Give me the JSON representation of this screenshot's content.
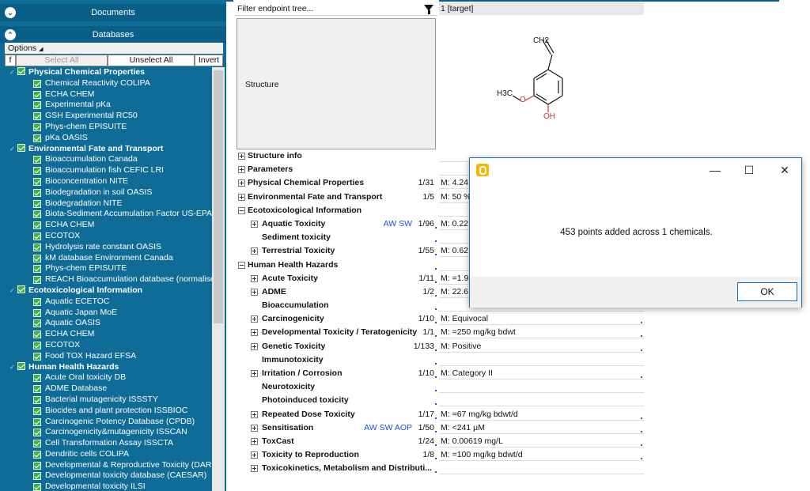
{
  "left_panel": {
    "documents_label": "Documents",
    "databases_label": "Databases",
    "options_label": "Options",
    "f_button": "f",
    "select_all": "Select All",
    "unselect_all": "Unselect All",
    "invert": "Invert",
    "categories": [
      {
        "name": "Physical Chemical Properties",
        "items": [
          "Chemical Reactivity COLIPA",
          "ECHA CHEM",
          "Experimental pKa",
          "GSH Experimental RC50",
          "Phys-chem EPISUITE",
          "pKa OASIS"
        ]
      },
      {
        "name": "Environmental Fate and Transport",
        "items": [
          "Bioaccumulation Canada",
          "Bioaccumulation fish CEFIC LRI",
          "Bioconcentration NITE",
          "Biodegradation in soil OASIS",
          "Biodegradation NITE",
          "Biota-Sediment Accumulation Factor US-EPA",
          "ECHA CHEM",
          "ECOTOX",
          "Hydrolysis rate constant OASIS",
          "kM database Environment Canada",
          "Phys-chem EPISUITE",
          "REACH Bioaccumulation database (normalised"
        ]
      },
      {
        "name": "Ecotoxicological Information",
        "items": [
          "Aquatic ECETOC",
          "Aquatic Japan MoE",
          "Aquatic OASIS",
          "ECHA CHEM",
          "ECOTOX",
          "Food TOX Hazard EFSA"
        ]
      },
      {
        "name": "Human Health Hazards",
        "items": [
          "Acute Oral toxicity DB",
          "ADME Database",
          "Bacterial mutagenicity ISSSTY",
          "Biocides and plant protection ISSBIOC",
          "Carcinogenic Potency Database (CPDB)",
          "Carcinogenicity&mutagenicity ISSCAN",
          "Cell Transformation Assay ISSCTA",
          "Dendritic cells COLIPA",
          "Developmental & Reproductive Toxicity (DAR",
          "Developmental toxicity database (CAESAR)",
          "Developmental toxicity ILSI"
        ]
      }
    ]
  },
  "center": {
    "filter_placeholder": "Filter endpoint tree...",
    "structure_label": "Structure",
    "target_label": "1 [target]",
    "rows": [
      {
        "name": "Structure info",
        "level": 0,
        "pm": "plus",
        "count": "",
        "tag": "",
        "value": ""
      },
      {
        "name": "Parameters",
        "level": 0,
        "pm": "plus",
        "count": "",
        "tag": "",
        "value": ""
      },
      {
        "name": "Physical Chemical Properties",
        "level": 0,
        "pm": "plus",
        "count": "1/31",
        "tag": "",
        "value": "M: 4.24"
      },
      {
        "name": "Environmental Fate and Transport",
        "level": 0,
        "pm": "plus",
        "count": "1/5",
        "tag": "",
        "value": "M: 50 %"
      },
      {
        "name": "Ecotoxicological Information",
        "level": 0,
        "pm": "minus",
        "count": "",
        "tag": "",
        "value": ""
      },
      {
        "name": "Aquatic Toxicity",
        "level": 1,
        "pm": "plus",
        "count": "1/96",
        "tag": "AW SW",
        "value": "M: 0.22"
      },
      {
        "name": "Sediment toxicity",
        "level": 1,
        "pm": "",
        "count": "",
        "tag": "",
        "value": ""
      },
      {
        "name": "Terrestrial Toxicity",
        "level": 1,
        "pm": "plus",
        "count": "1/55",
        "tag": "",
        "value": "M: 0.62"
      },
      {
        "name": "Human Health Hazards",
        "level": 0,
        "pm": "minus",
        "count": "",
        "tag": "",
        "value": ""
      },
      {
        "name": "Acute Toxicity",
        "level": 1,
        "pm": "plus",
        "count": "1/11",
        "tag": "",
        "value": "M: =1.93"
      },
      {
        "name": "ADME",
        "level": 1,
        "pm": "plus",
        "count": "1/2",
        "tag": "",
        "value": "M: 22.6"
      },
      {
        "name": "Bioaccumulation",
        "level": 1,
        "pm": "",
        "count": "",
        "tag": "",
        "value": ""
      },
      {
        "name": "Carcinogenicity",
        "level": 1,
        "pm": "plus",
        "count": "1/10",
        "tag": "",
        "value": "M: Equivocal"
      },
      {
        "name": "Developmental Toxicity / Teratogenicity",
        "level": 1,
        "pm": "plus",
        "count": "1/1",
        "tag": "",
        "value": "M: =250 mg/kg bdwt"
      },
      {
        "name": "Genetic Toxicity",
        "level": 1,
        "pm": "plus",
        "count": "1/133",
        "tag": "",
        "value": "M: Positive"
      },
      {
        "name": "Immunotoxicity",
        "level": 1,
        "pm": "",
        "count": "",
        "tag": "",
        "value": ""
      },
      {
        "name": "Irritation / Corrosion",
        "level": 1,
        "pm": "plus",
        "count": "1/10",
        "tag": "",
        "value": "M: Category II"
      },
      {
        "name": "Neurotoxicity",
        "level": 1,
        "pm": "",
        "count": "",
        "tag": "",
        "value": ""
      },
      {
        "name": "Photoinduced toxicity",
        "level": 1,
        "pm": "",
        "count": "",
        "tag": "",
        "value": ""
      },
      {
        "name": "Repeated Dose Toxicity",
        "level": 1,
        "pm": "plus",
        "count": "1/17",
        "tag": "",
        "value": "M: =67 mg/kg bdwt/d"
      },
      {
        "name": "Sensitisation",
        "level": 1,
        "pm": "plus",
        "count": "1/50",
        "tag": "AW SW AOP",
        "value": "M: <241 µM"
      },
      {
        "name": "ToxCast",
        "level": 1,
        "pm": "plus",
        "count": "1/24",
        "tag": "",
        "value": "M: 0.00619 mg/L"
      },
      {
        "name": "Toxicity to Reproduction",
        "level": 1,
        "pm": "plus",
        "count": "1/8",
        "tag": "",
        "value": "M: =100 mg/kg bdwt/d"
      },
      {
        "name": "Toxicokinetics, Metabolism and Distributi...",
        "level": 1,
        "pm": "plus",
        "count": "",
        "tag": "",
        "value": ""
      }
    ],
    "structure_labels": {
      "ch2": "CH2",
      "h3c": "H3C",
      "o": "O",
      "oh": "OH"
    }
  },
  "dialog": {
    "message": "453 points added across 1 chemicals.",
    "ok_label": "OK",
    "minimize": "—",
    "maximize": "☐",
    "close": "✕"
  }
}
